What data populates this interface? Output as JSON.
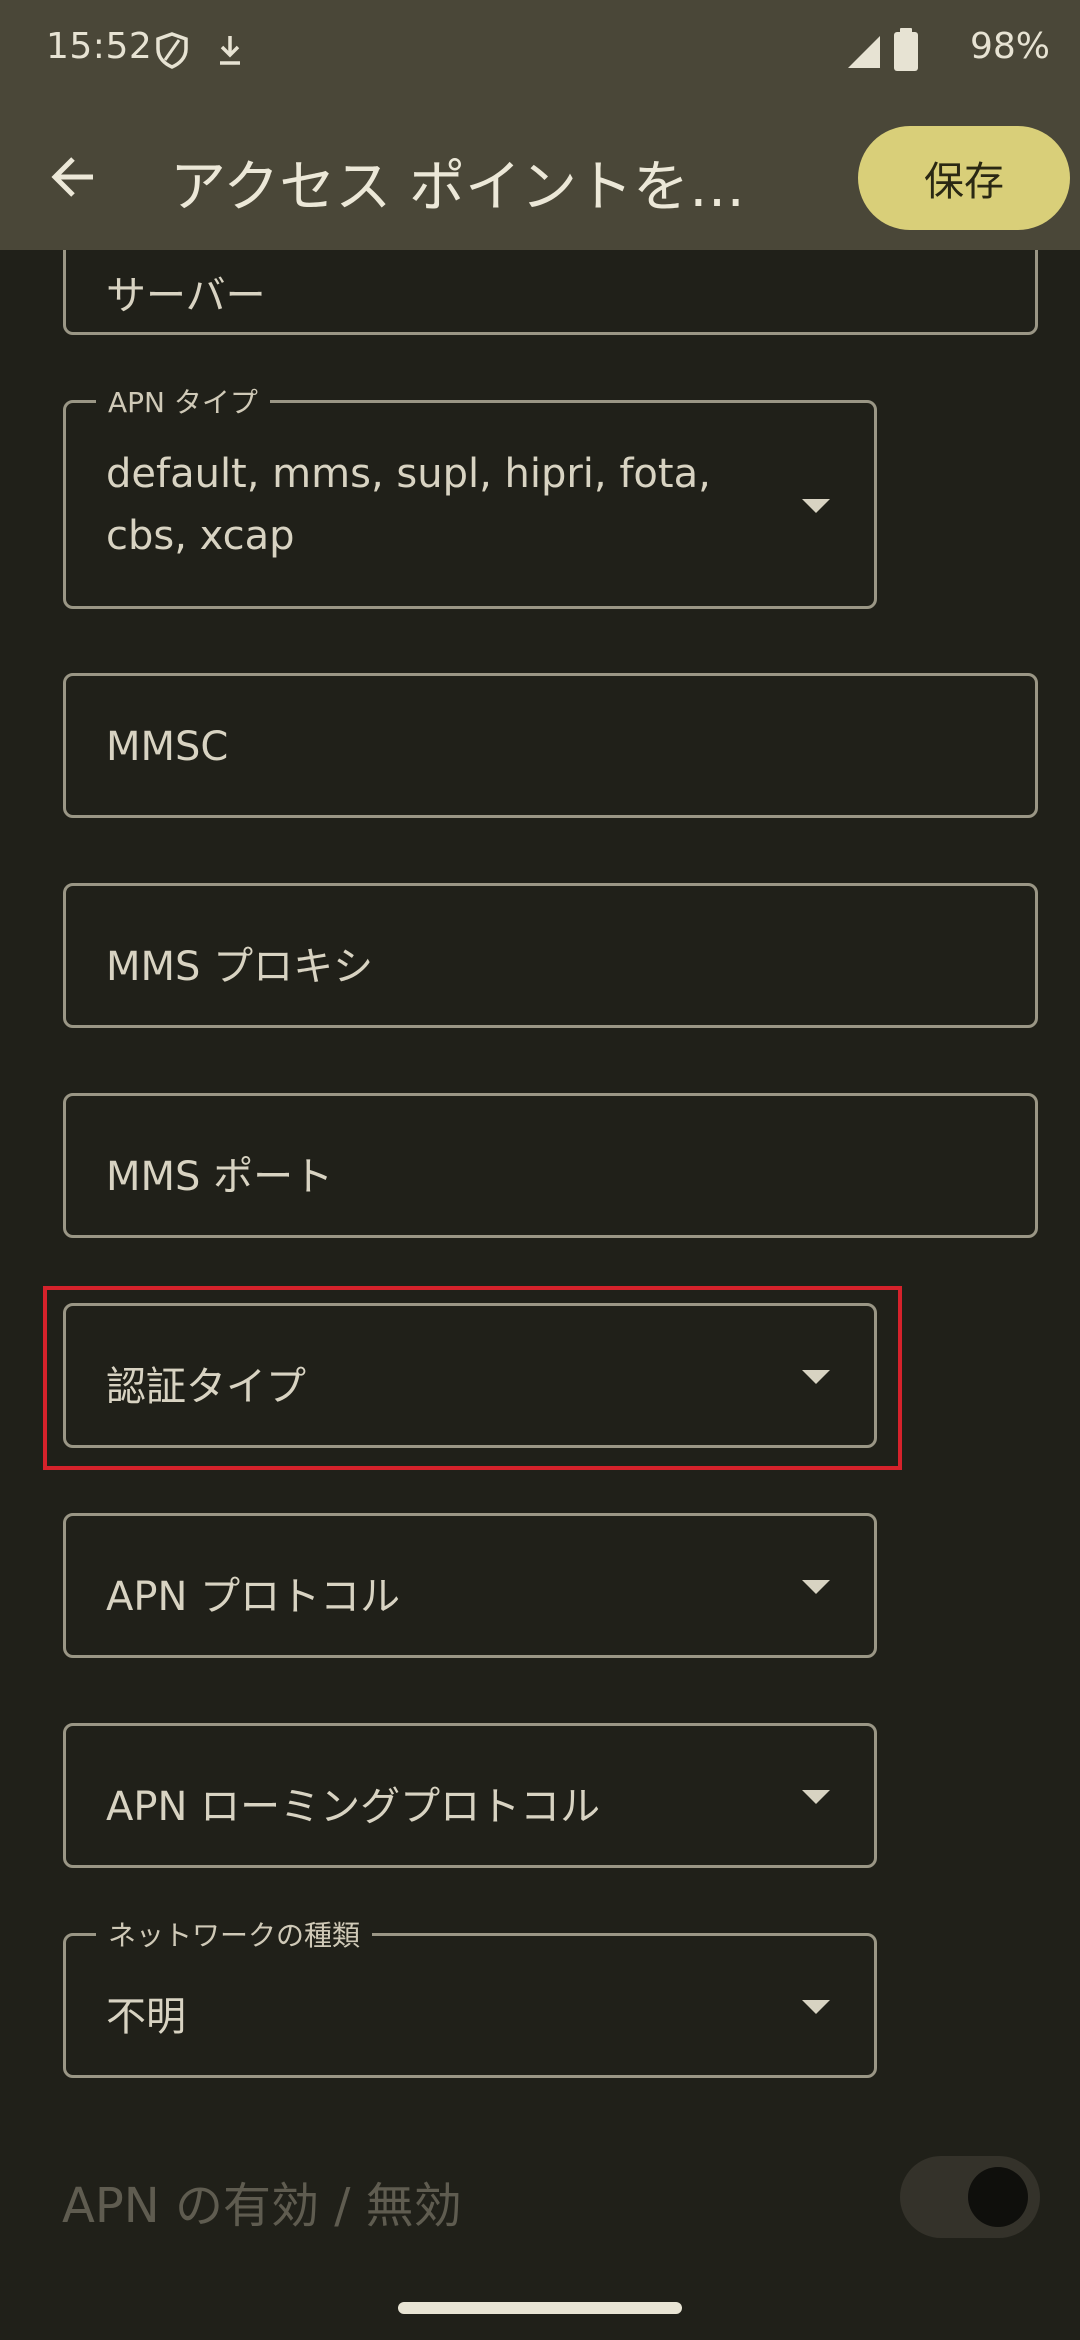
{
  "status_bar": {
    "time": "15:52",
    "battery_text": "98%",
    "icons": [
      "vpn-shield-icon",
      "download-icon",
      "cellular-signal-icon",
      "battery-icon"
    ]
  },
  "app_bar": {
    "back_icon": "back-arrow-icon",
    "title": "アクセス ポイントを…",
    "save_label": "保存"
  },
  "fields": {
    "server": {
      "value": "サーバー"
    },
    "apn_type": {
      "label": "APN タイプ",
      "value": "default, mms, supl, hipri, fota, cbs, xcap"
    },
    "mmsc": {
      "value": "MMSC"
    },
    "mms_proxy": {
      "value": "MMS プロキシ"
    },
    "mms_port": {
      "value": "MMS ポート"
    },
    "auth_type": {
      "value": "認証タイプ"
    },
    "apn_protocol": {
      "value": "APN プロトコル"
    },
    "apn_roaming_protocol": {
      "value": "APN ローミングプロトコル"
    },
    "network_type": {
      "label": "ネットワークの種類",
      "value": "不明"
    }
  },
  "apn_enable": {
    "label": "APN の有効 / 無効"
  },
  "colors": {
    "app_bar": "#4a4738",
    "background": "#202019",
    "accent_button": "#d9cf79",
    "highlight": "#d5222b"
  }
}
